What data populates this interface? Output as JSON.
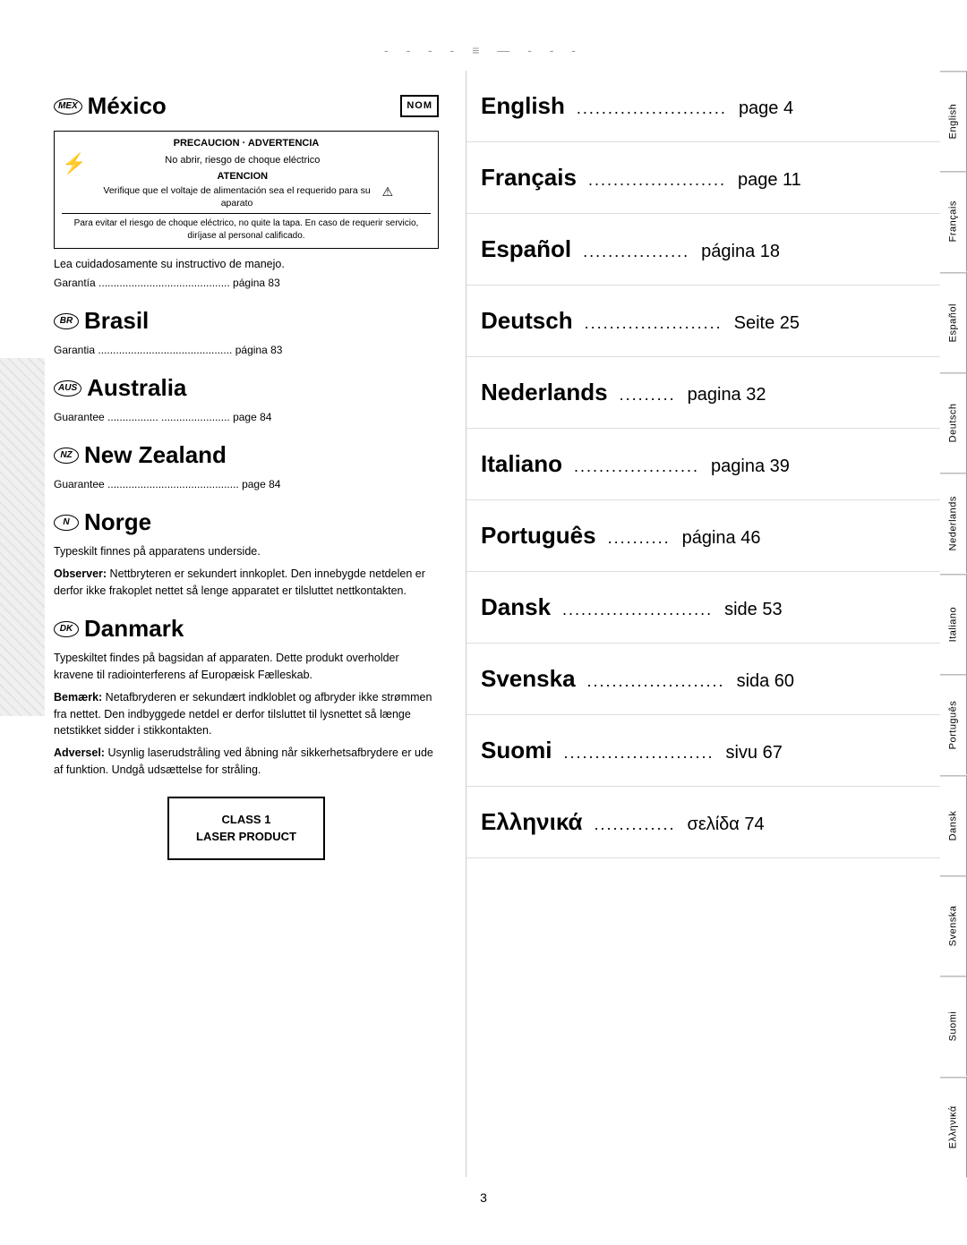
{
  "page": {
    "top_decoration": "- - - - ≡ — - - -",
    "page_number": "3"
  },
  "left": {
    "mexico": {
      "badge": "MEX",
      "title": "México",
      "nom": "NOM",
      "warning": {
        "precaucion": "PRECAUCION · ADVERTENCIA",
        "no_abrir": "No abrir, riesgo de choque eléctrico",
        "atencion": "ATENCION",
        "verificque": "Verifique que el voltaje de alimentación sea el requerido para su aparato",
        "para_evitar": "Para evitar el riesgo de choque eléctrico, no quite la tapa. En caso de requerir servicio, diríjase al personal calificado."
      },
      "lea_text": "Lea cuidadosamente su instructivo de manejo.",
      "garantia_dotted": "Garantía  ............................................  página 83"
    },
    "brasil": {
      "badge": "BR",
      "title": "Brasil",
      "garantia_dotted": "Garantia  .............................................  página 83"
    },
    "australia": {
      "badge": "AUS",
      "title": "Australia",
      "guarantee_dotted": "Guarantee  .................  .......................  page 84"
    },
    "new_zealand": {
      "badge": "NZ",
      "title": "New Zealand",
      "guarantee_dotted": "Guarantee  ............................................  page 84"
    },
    "norge": {
      "badge": "N",
      "title": "Norge",
      "text1": "Typeskilt finnes på apparatens underside.",
      "observer_label": "Observer:",
      "text2": "Nettbryteren er sekundert innkoplet. Den innebygde netdelen er derfor ikke frakoplet nettet så lenge apparatet er tilsluttet nettkontakten."
    },
    "danmark": {
      "badge": "DK",
      "title": "Danmark",
      "text1": "Typeskiltet findes på bagsidan af apparaten. Dette produkt overholder kravene til radiointerferens af Europæisk Fælleskab.",
      "bemaerk_label": "Bemærk:",
      "text2": "Netafbryderen er sekundært indkloblet og afbryder ikke strømmen fra nettet. Den indbyggede netdel er derfor tilsluttet til lysnettet så længe netstikket sidder i stikkontakten.",
      "adversel_label": "Adversel:",
      "text3": "Usynlig laserudstråling ved åbning når sikkerhetsafbrydere er ude af funktion. Undgå udsættelse for stråling."
    },
    "laser": {
      "line1": "CLASS 1",
      "line2": "LASER PRODUCT"
    }
  },
  "right": {
    "languages": [
      {
        "name": "English",
        "dots": "........................",
        "page_text": "page 4",
        "tab": "English"
      },
      {
        "name": "Français",
        "dots": "......................",
        "page_text": "page 11",
        "tab": "Français"
      },
      {
        "name": "Español",
        "dots": ".................",
        "page_text": "página 18",
        "tab": "Español"
      },
      {
        "name": "Deutsch",
        "dots": "......................",
        "page_text": "Seite 25",
        "tab": "Deutsch"
      },
      {
        "name": "Nederlands",
        "dots": ".........",
        "page_text": "pagina 32",
        "tab": "Nederlands"
      },
      {
        "name": "Italiano",
        "dots": "....................",
        "page_text": "pagina 39",
        "tab": "Italiano"
      },
      {
        "name": "Português",
        "dots": "..........",
        "page_text": "página 46",
        "tab": "Português"
      },
      {
        "name": "Dansk",
        "dots": "........................",
        "page_text": "side 53",
        "tab": "Dansk"
      },
      {
        "name": "Svenska",
        "dots": "......................",
        "page_text": "sida 60",
        "tab": "Svenska"
      },
      {
        "name": "Suomi",
        "dots": "........................",
        "page_text": "sivu 67",
        "tab": "Suomi"
      },
      {
        "name": "Ελληνικά",
        "dots": ".............",
        "page_text": "σελίδα 74",
        "tab": "Ελληνικά"
      }
    ]
  }
}
